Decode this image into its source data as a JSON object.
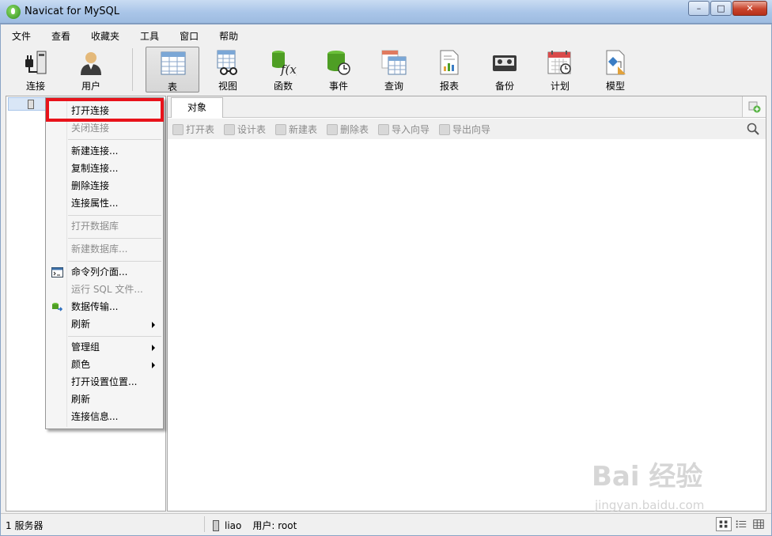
{
  "window": {
    "title": "Navicat for MySQL"
  },
  "menubar": [
    "文件",
    "查看",
    "收藏夹",
    "工具",
    "窗口",
    "帮助"
  ],
  "toolbar": [
    {
      "label": "连接",
      "icon": "plug-icon"
    },
    {
      "label": "用户",
      "icon": "user-icon"
    },
    {
      "label": "表",
      "icon": "table-icon",
      "active": true
    },
    {
      "label": "视图",
      "icon": "view-icon"
    },
    {
      "label": "函数",
      "icon": "function-icon"
    },
    {
      "label": "事件",
      "icon": "event-icon"
    },
    {
      "label": "查询",
      "icon": "query-icon"
    },
    {
      "label": "报表",
      "icon": "report-icon"
    },
    {
      "label": "备份",
      "icon": "backup-icon"
    },
    {
      "label": "计划",
      "icon": "schedule-icon"
    },
    {
      "label": "模型",
      "icon": "model-icon"
    }
  ],
  "objects": {
    "tab_label": "对象",
    "actions": [
      "打开表",
      "设计表",
      "新建表",
      "删除表",
      "导入向导",
      "导出向导"
    ]
  },
  "context_menu": {
    "items": [
      {
        "label": "打开连接",
        "disabled": false
      },
      {
        "label": "关闭连接",
        "disabled": true
      },
      {
        "label": "新建连接...",
        "disabled": false
      },
      {
        "label": "复制连接...",
        "disabled": false
      },
      {
        "label": "删除连接",
        "disabled": false
      },
      {
        "label": "连接属性...",
        "disabled": false
      },
      {
        "label": "打开数据库",
        "disabled": true
      },
      {
        "label": "新建数据库...",
        "disabled": true
      },
      {
        "label": "命令列介面...",
        "disabled": false
      },
      {
        "label": "运行 SQL 文件...",
        "disabled": true
      },
      {
        "label": "数据传输...",
        "disabled": false
      },
      {
        "label": "刷新",
        "disabled": false
      },
      {
        "label": "管理组",
        "disabled": false
      },
      {
        "label": "颜色",
        "disabled": false
      },
      {
        "label": "打开设置位置...",
        "disabled": false
      },
      {
        "label": "刷新",
        "disabled": false
      },
      {
        "label": "连接信息...",
        "disabled": false
      }
    ]
  },
  "statusbar": {
    "servers": "1 服务器",
    "connection": "liao",
    "user": "用户: root"
  },
  "colors": {
    "highlight": "#e8131b",
    "accent": "#2f7fbf"
  },
  "watermark": {
    "brand": "Bai 经验",
    "url": "jingyan.baidu.com"
  }
}
